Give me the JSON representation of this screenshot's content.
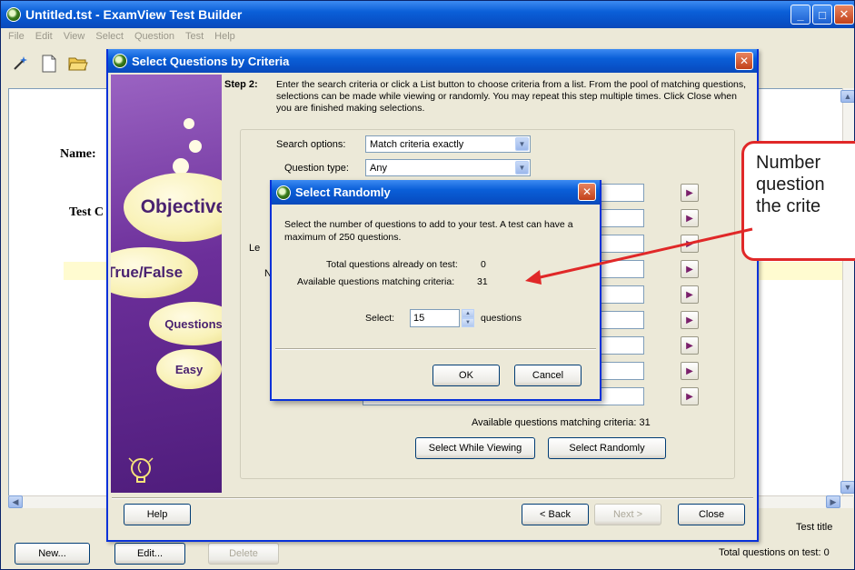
{
  "app": {
    "title": "Untitled.tst - ExamView Test Builder",
    "menu": [
      "File",
      "Edit",
      "View",
      "Select",
      "Question",
      "Test",
      "Help"
    ],
    "doc": {
      "name_label": "Name:",
      "test_label": "Test C"
    },
    "bottom": {
      "new_label": "New...",
      "edit_label": "Edit...",
      "delete_label": "Delete",
      "test_title": "Test title",
      "total_questions": "Total questions on test: 0"
    }
  },
  "criteria_dialog": {
    "title": "Select Questions by Criteria",
    "side_bubbles": [
      "Objective",
      "True/False",
      "Questions",
      "Easy"
    ],
    "step_label": "Step 2:",
    "step_text": "Enter the search criteria or click a List button to choose criteria from a list. From the pool of matching questions, selections can be made while viewing or randomly. You may repeat this step multiple times. Click Close when you are finished making selections.",
    "search_options_label": "Search options:",
    "search_options_value": "Match criteria exactly",
    "question_type_label": "Question type:",
    "question_type_value": "Any",
    "partial_label_le": "Le",
    "partial_label_n": "N",
    "available_text": "Available questions matching criteria: 31",
    "select_while_viewing": "Select While Viewing",
    "select_randomly": "Select Randomly",
    "help_label": "Help",
    "back_label": "< Back",
    "next_label": "Next >",
    "close_label": "Close"
  },
  "random_dialog": {
    "title": "Select Randomly",
    "description": "Select the number of questions to add to your test. A test can have a maximum of 250 questions.",
    "total_label": "Total questions already on test:",
    "total_value": "0",
    "available_label": "Available questions matching criteria:",
    "available_value": "31",
    "select_label": "Select:",
    "select_value": "15",
    "questions_label": "questions",
    "ok_label": "OK",
    "cancel_label": "Cancel"
  },
  "callout": {
    "line1": "Number",
    "line2": "question",
    "line3": "the crite",
    "color": "#e02828"
  },
  "colors": {
    "titlebar": "#0a5fd8",
    "dialog_bg": "#ece9d8",
    "side_panel": "#6c2f9a",
    "bubble": "#f9f2b8"
  }
}
